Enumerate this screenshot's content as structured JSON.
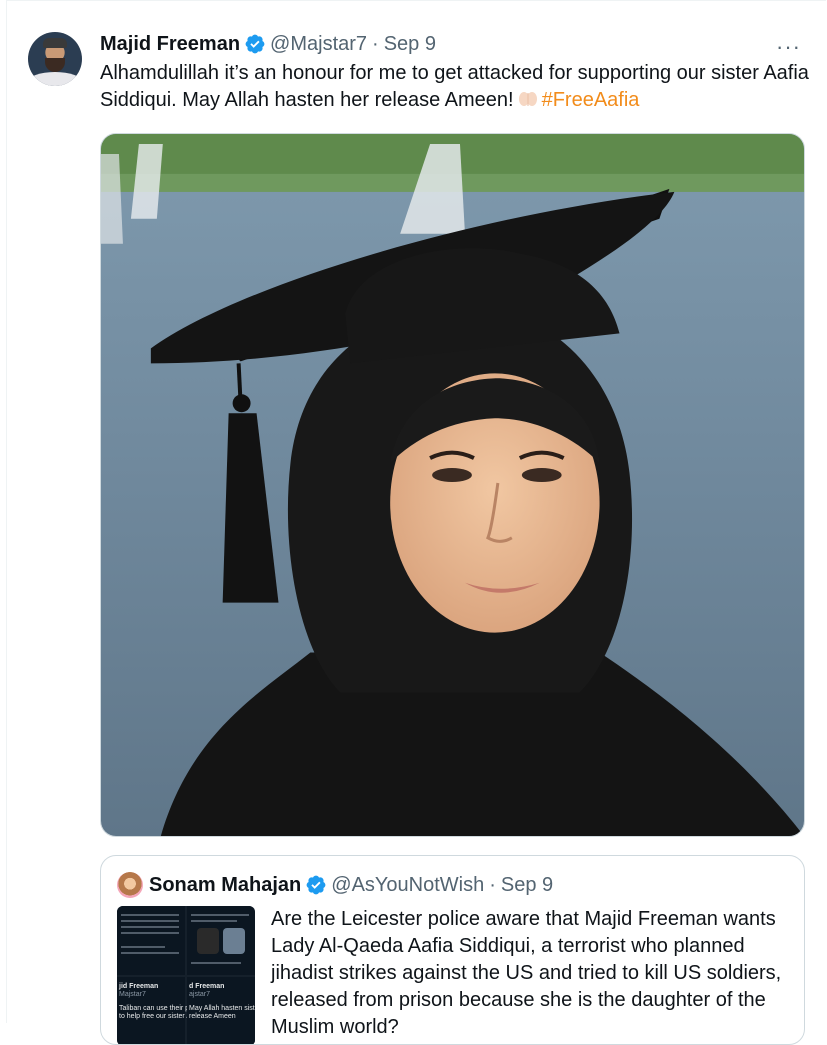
{
  "tweet": {
    "author_name": "Majid Freeman",
    "author_handle": "@Majstar7",
    "separator": "·",
    "date": "Sep 9",
    "more_label": "···",
    "text": "Alhamdulillah it’s an honour for me to get attacked for supporting our sister Aafia Siddiqui. May Allah hasten her release Ameen!",
    "emoji_icon": "raising-hands-icon",
    "hashtag": "#FreeAafia",
    "hashtag_color": "#f28c1b",
    "verified_color": "#1d9bf0"
  },
  "quoted_tweet": {
    "author_name": "Sonam Mahajan",
    "author_handle": "@AsYouNotWish",
    "separator": "·",
    "date": "Sep 9",
    "text": "Are the Leicester police aware that Majid Freeman wants Lady Al-Qaeda Aafia Siddiqui, a terrorist who planned jihadist strikes against the US and tried to kill US soldiers, released from prison because she is the daughter of the Muslim world?",
    "thumb_labels": {
      "left_name": "jid Freeman",
      "left_handle": "Majstar7",
      "left_body": "Taliban can use their pow\nto help free our sister Aafi",
      "right_name": "d Freeman",
      "right_handle": "ajstar7",
      "right_body": "May Allah hasten siste\nrelease Ameen"
    }
  }
}
